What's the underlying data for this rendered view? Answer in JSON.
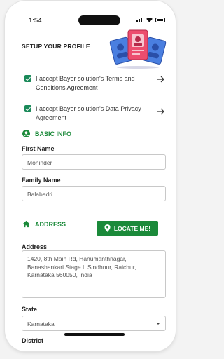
{
  "status_bar": {
    "time": "1:54"
  },
  "page": {
    "title": "SETUP YOUR PROFILE"
  },
  "agreements": [
    {
      "label": "I accept Bayer solution's Terms and Conditions Agreement",
      "checked": true
    },
    {
      "label": "I accept Bayer solution's Data Privacy Agreement",
      "checked": true
    }
  ],
  "basic_info": {
    "heading": "BASIC INFO",
    "first_name": {
      "label": "First Name",
      "value": "Mohinder"
    },
    "family_name": {
      "label": "Family Name",
      "value": "Balabadri"
    }
  },
  "address_section": {
    "heading": "ADDRESS",
    "locate_button": "LOCATE ME!",
    "address": {
      "label": "Address",
      "value": "1420, 8th Main Rd, Hanumanthnagar, Banashankari Stage I, Sindhnur, Raichur, Karnataka 560050, India"
    },
    "state": {
      "label": "State",
      "value": "Karnataka"
    },
    "district_label_partial": "District"
  },
  "colors": {
    "accent_green": "#1b8a3a",
    "checkbox_green": "#1b8a5a"
  },
  "icons": [
    "user-circle-icon",
    "home-icon",
    "location-pin-icon",
    "arrow-right-icon",
    "check-icon",
    "chevron-down-icon"
  ]
}
